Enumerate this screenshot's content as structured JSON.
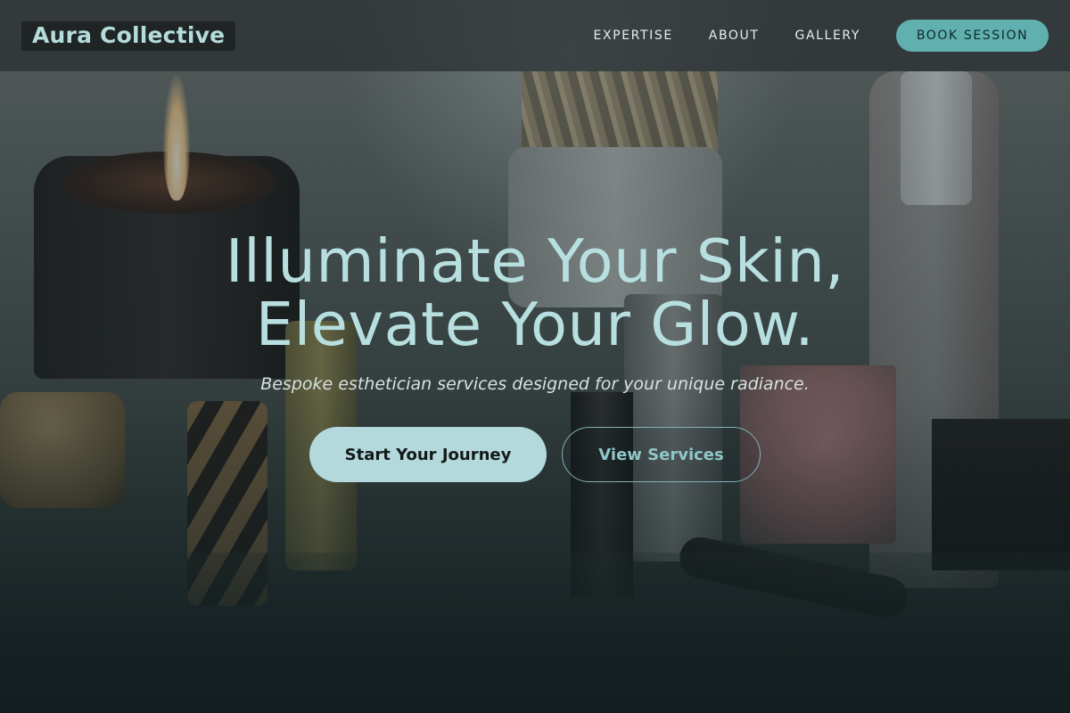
{
  "header": {
    "logo": "Aura Collective",
    "nav": [
      {
        "label": "EXPERTISE"
      },
      {
        "label": "ABOUT"
      },
      {
        "label": "GALLERY"
      }
    ],
    "cta_label": "BOOK SESSION"
  },
  "hero": {
    "headline_line1": "Illuminate Your Skin,",
    "headline_line2": "Elevate Your Glow.",
    "subtitle": "Bespoke esthetician services designed for your unique radiance.",
    "primary_button": "Start Your Journey",
    "secondary_button": "View Services"
  },
  "colors": {
    "accent": "#5fb0ae",
    "headline": "#b8dfe0",
    "primary_button_bg": "#b3d9dc"
  }
}
